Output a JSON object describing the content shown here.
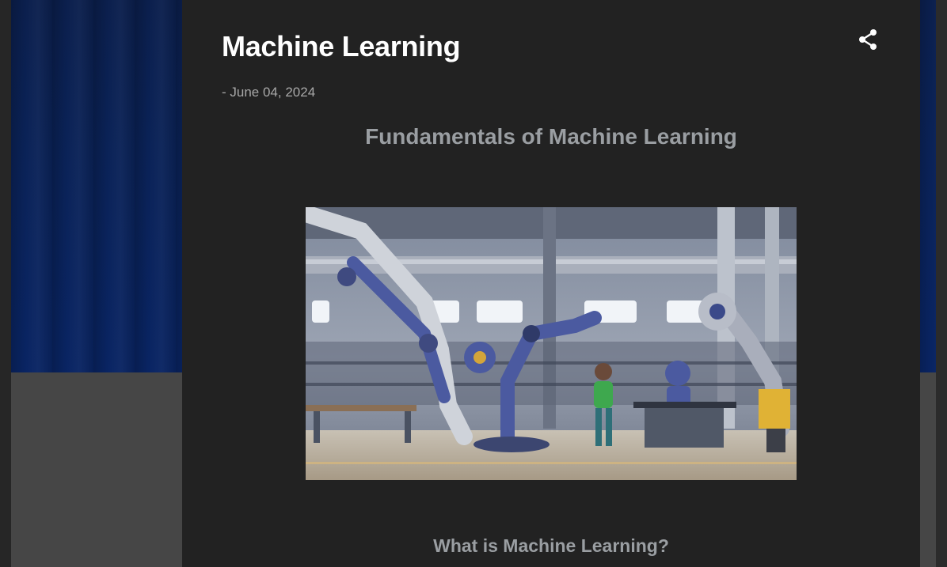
{
  "post": {
    "title": "Machine Learning",
    "date": "- June 04, 2024",
    "subtitle": "Fundamentals of Machine Learning",
    "section_heading": "What is Machine Learning?",
    "share_icon": "share-icon",
    "image_icon": "robot-factory-illustration"
  },
  "colors": {
    "post_background": "#222222",
    "title": "#ffffff",
    "date": "#a8a8a8",
    "heading": "#9a9ea2",
    "hero_background": "#0a2257",
    "lower_background": "#464646"
  }
}
